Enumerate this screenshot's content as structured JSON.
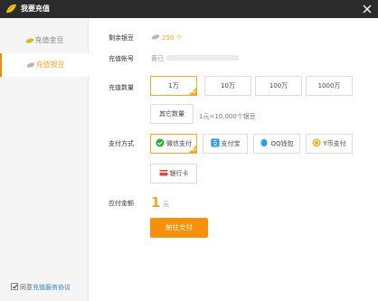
{
  "window": {
    "title": "我要充值"
  },
  "sidebar": {
    "items": [
      {
        "label": "充值金豆",
        "active": false
      },
      {
        "label": "充值银豆",
        "active": true
      }
    ]
  },
  "agreement": {
    "prefix": "同意",
    "link": "充值服务协议"
  },
  "balance": {
    "label": "剩余银豆",
    "value": "250 个"
  },
  "account": {
    "label": "充值帐号",
    "value": "黄已"
  },
  "quantity": {
    "label": "充值数量",
    "options": [
      "1万",
      "10万",
      "100万",
      "1000万"
    ],
    "selected": "1万",
    "other_label": "其它数量",
    "note": "1元=10,000个银豆"
  },
  "payment": {
    "label": "支付方式",
    "methods": [
      "微信支付",
      "支付宝",
      "QQ钱包",
      "Y币支付",
      "银行卡"
    ],
    "selected": "微信支付"
  },
  "amount": {
    "label": "应付金额",
    "value": "1",
    "unit": "元"
  },
  "pay_button": "前往支付",
  "colors": {
    "accent": "#f5a623",
    "button": "#f5900a",
    "titlebar": "#2b2b2b",
    "link": "#2f80d1"
  }
}
